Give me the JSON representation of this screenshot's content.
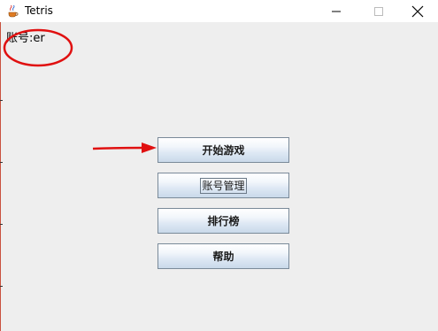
{
  "window": {
    "title": "Tetris",
    "icon": "java-coffee-icon",
    "controls": {
      "minimize_icon": "minimize-icon",
      "maximize_icon": "maximize-icon",
      "close_icon": "close-icon"
    }
  },
  "account": {
    "label": "账号:er"
  },
  "menu": {
    "start_game": "开始游戏",
    "account_manage": "账号管理",
    "leaderboard": "排行榜",
    "help": "帮助"
  },
  "colors": {
    "window_bg": "#eeeeee",
    "annotation_red": "#e01010",
    "button_border": "#7a8a99"
  }
}
